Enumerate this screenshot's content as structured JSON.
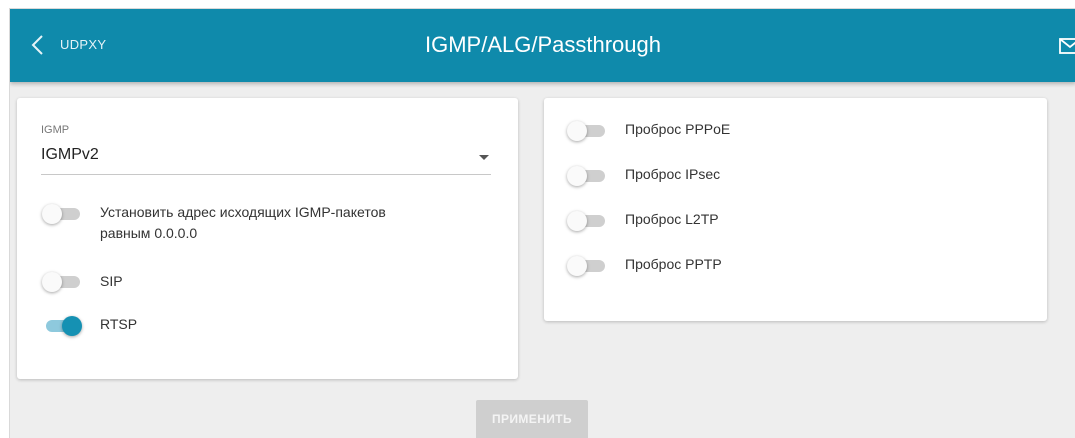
{
  "header": {
    "back_label": "UDPXY",
    "title": "IGMP/ALG/Passthrough"
  },
  "igmp": {
    "label": "IGMP",
    "selected": "IGMPv2"
  },
  "left_options": [
    {
      "label": "Установить адрес исходящих IGMP-пакетов\nравным 0.0.0.0",
      "enabled": false
    },
    {
      "label": "SIP",
      "enabled": false
    },
    {
      "label": "RTSP",
      "enabled": true
    }
  ],
  "right_options": [
    {
      "label": "Проброс PPPoE",
      "enabled": false
    },
    {
      "label": "Проброс IPsec",
      "enabled": false
    },
    {
      "label": "Проброс L2TP",
      "enabled": false
    },
    {
      "label": "Проброс PPTP",
      "enabled": false
    }
  ],
  "apply_label": "ПРИМЕНИТЬ",
  "colors": {
    "header": "#0f8aab",
    "toggle_on": "#1591b3",
    "background": "#eeeeee"
  }
}
